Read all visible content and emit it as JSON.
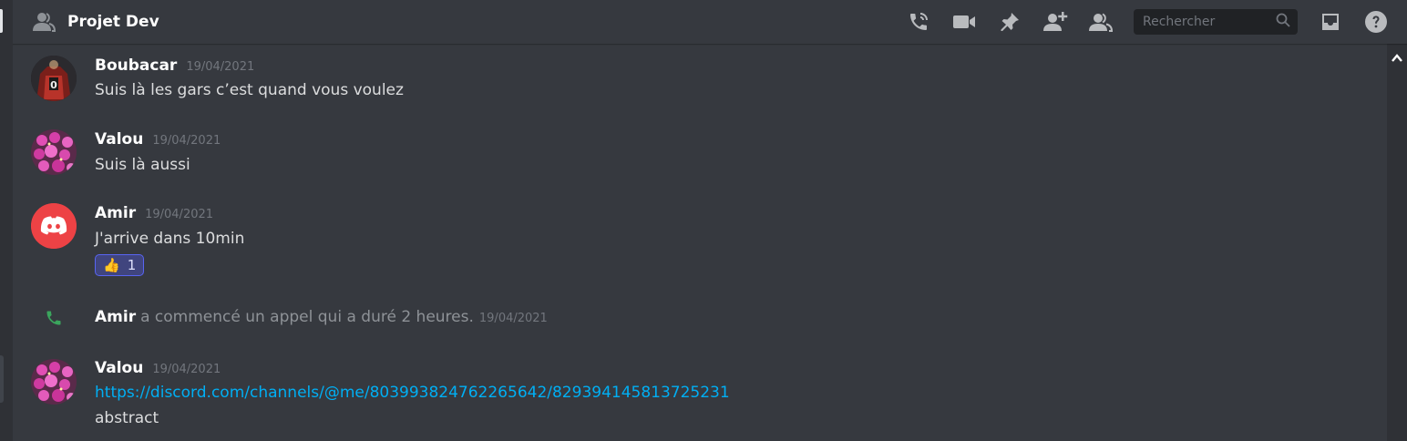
{
  "header": {
    "channel_name": "Projet Dev",
    "search": {
      "placeholder": "Rechercher"
    },
    "icons": [
      "members-dm-icon",
      "call-icon",
      "video-icon",
      "pin-icon",
      "add-friend-icon",
      "members-icon",
      "search-icon",
      "inbox-icon",
      "help-icon"
    ]
  },
  "messages": [
    {
      "author": "Boubacar",
      "timestamp": "19/04/2021",
      "content": "Suis là les gars c’est quand vous voulez",
      "avatar": "jersey-avatar"
    },
    {
      "author": "Valou",
      "timestamp": "19/04/2021",
      "content": "Suis là aussi",
      "avatar": "flowers-avatar"
    },
    {
      "author": "Amir",
      "timestamp": "19/04/2021",
      "content": "J'arrive dans 10min",
      "avatar": "discord-default-avatar",
      "reaction": {
        "emoji": "👍",
        "count": "1"
      }
    },
    {
      "author": "Valou",
      "timestamp": "19/04/2021",
      "link": "https://discord.com/channels/@me/803993824762265642/829394145813725231",
      "content": "abstract",
      "avatar": "flowers-avatar"
    }
  ],
  "system_message": {
    "author": "Amir",
    "text": "a commencé un appel qui a duré 2 heures.",
    "timestamp": "19/04/2021"
  },
  "colors": {
    "background": "#36393f",
    "link": "#00aff4",
    "call_green": "#3ba55d",
    "discord_red": "#ed4245",
    "reaction_bg": "#40457e"
  }
}
